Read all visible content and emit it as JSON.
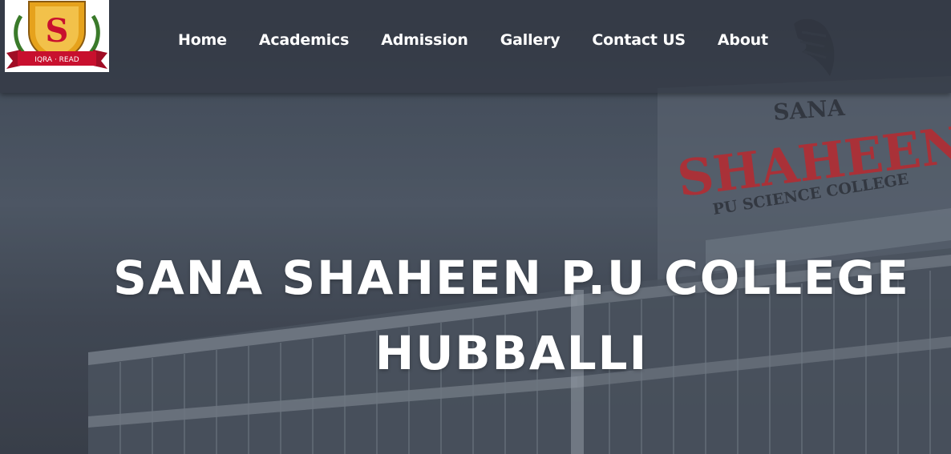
{
  "logo": {
    "motto": "IQRA · READ",
    "monogram": "S"
  },
  "nav": {
    "items": [
      {
        "label": "Home"
      },
      {
        "label": "Academics"
      },
      {
        "label": "Admission"
      },
      {
        "label": "Gallery"
      },
      {
        "label": "Contact US"
      },
      {
        "label": "About"
      }
    ]
  },
  "hero": {
    "title_line1": "SANA SHAHEEN P.U COLLEGE",
    "title_line2": "HUBBALLI",
    "building_sign": {
      "top": "SANA",
      "main": "SHAHEEN",
      "sub": "PU SCIENCE COLLEGE"
    }
  },
  "colors": {
    "overlay": "#323742",
    "text": "#ffffff",
    "sign_red": "#c8202a",
    "shield_gold": "#e6a21c",
    "ribbon_red": "#c8102e"
  }
}
